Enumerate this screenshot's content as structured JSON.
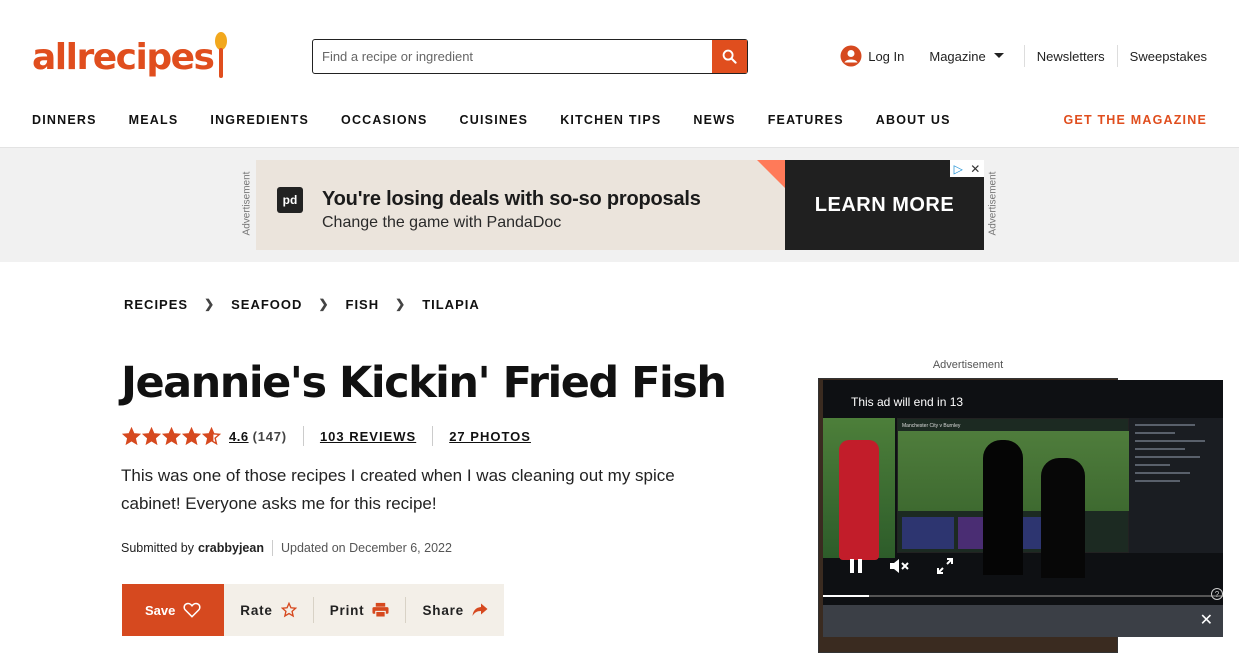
{
  "brand": {
    "logo_text": "allrecipes",
    "accent": "#e04e1e"
  },
  "search": {
    "placeholder": "Find a recipe or ingredient"
  },
  "topnav": {
    "login": "Log In",
    "magazine": "Magazine",
    "newsletters": "Newsletters",
    "sweepstakes": "Sweepstakes"
  },
  "mainnav": {
    "items": [
      "DINNERS",
      "MEALS",
      "INGREDIENTS",
      "OCCASIONS",
      "CUISINES",
      "KITCHEN TIPS",
      "NEWS",
      "FEATURES",
      "ABOUT US"
    ],
    "cta": "GET THE MAGAZINE"
  },
  "ad_banner": {
    "side_label": "Advertisement",
    "logo": "pd",
    "headline": "You're losing deals with so-so proposals",
    "subline": "Change the game with PandaDoc",
    "cta": "LEARN MORE"
  },
  "breadcrumbs": [
    "RECIPES",
    "SEAFOOD",
    "FISH",
    "TILAPIA"
  ],
  "recipe": {
    "title": "Jeannie's Kickin' Fried Fish",
    "rating": "4.6",
    "rating_value": 4.6,
    "rating_count": "(147)",
    "reviews": "103 REVIEWS",
    "photos": "27 PHOTOS",
    "description": "This was one of those recipes I created when I was cleaning out my spice cabinet! Everyone asks me for this recipe!",
    "submitted_prefix": "Submitted by",
    "author": "crabbyjean",
    "updated": "Updated on December 6, 2022"
  },
  "actions": {
    "save": "Save",
    "rate": "Rate",
    "print": "Print",
    "share": "Share"
  },
  "video_ad": {
    "label": "Advertisement",
    "timer": "This ad will end in 13",
    "tv_caption": "Manchester City v Burnley",
    "progress": 0.115
  }
}
